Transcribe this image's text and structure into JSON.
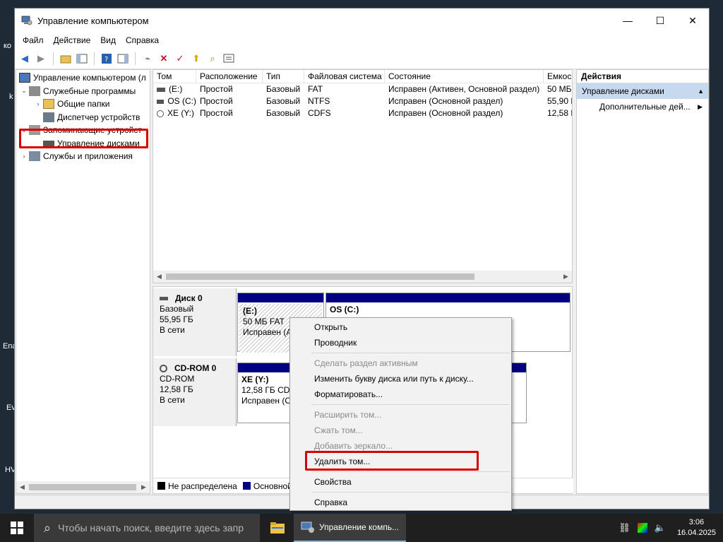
{
  "window": {
    "title": "Управление компьютером",
    "min": "—",
    "max": "☐",
    "close": "✕"
  },
  "menu": [
    "Файл",
    "Действие",
    "Вид",
    "Справка"
  ],
  "tree": [
    {
      "label": "Управление компьютером (л",
      "level": 0,
      "exp": ""
    },
    {
      "label": "Служебные программы",
      "level": 1,
      "exp": "⌄"
    },
    {
      "label": "Общие папки",
      "level": 2,
      "exp": "›"
    },
    {
      "label": "Диспетчер устройств",
      "level": 2,
      "exp": ""
    },
    {
      "label": "Запоминающие устройст",
      "level": 1,
      "exp": "⌄"
    },
    {
      "label": "Управление дисками",
      "level": 2,
      "exp": ""
    },
    {
      "label": "Службы и приложения",
      "level": 1,
      "exp": "›"
    }
  ],
  "volume_table": {
    "headers": [
      "Том",
      "Расположение",
      "Тип",
      "Файловая система",
      "Состояние",
      "Емкос"
    ],
    "rows": [
      [
        "(E:)",
        "Простой",
        "Базовый",
        "FAT",
        "Исправен (Активен, Основной раздел)",
        "50 МБ"
      ],
      [
        "OS (C:)",
        "Простой",
        "Базовый",
        "NTFS",
        "Исправен (Основной раздел)",
        "55,90 Г"
      ],
      [
        "XE (Y:)",
        "Простой",
        "Базовый",
        "CDFS",
        "Исправен (Основной раздел)",
        "12,58 Г"
      ]
    ]
  },
  "disks": {
    "disk0": {
      "name": "Диск 0",
      "type": "Базовый",
      "size": "55,95 ГБ",
      "status": "В сети"
    },
    "disk0_p1": {
      "title": "(E:)",
      "line1": "50 МБ FAT",
      "line2": "Исправен (А"
    },
    "disk0_p2": {
      "title": "OS  (C:)"
    },
    "cdrom": {
      "name": "CD-ROM 0",
      "type": "CD-ROM",
      "size": "12,58 ГБ",
      "status": "В сети"
    },
    "cdrom_p1": {
      "title": "XE  (Y:)",
      "line1": "12,58 ГБ CDF",
      "line2": "Исправен (О"
    }
  },
  "legend": {
    "unallocated": "Не распределена",
    "primary": "Основной",
    "unallocated_color": "#000000",
    "primary_color": "#000080"
  },
  "actions": {
    "header": "Действия",
    "section": "Управление дисками",
    "item": "Дополнительные дей..."
  },
  "context_menu": {
    "open": "Открыть",
    "explore": "Проводник",
    "mark_active": "Сделать раздел активным",
    "change_letter": "Изменить букву диска или путь к диску...",
    "format": "Форматировать...",
    "extend": "Расширить том...",
    "shrink": "Сжать том...",
    "mirror": "Добавить зеркало...",
    "delete": "Удалить том...",
    "properties": "Свойства",
    "help": "Справка"
  },
  "taskbar": {
    "search_placeholder": "Чтобы начать поиск, введите здесь запр",
    "app_label": "Управление компь...",
    "time": "3:06",
    "date": "16.04.2025"
  },
  "desktop_fragments": [
    "Ena",
    "Ev",
    "HV",
    "ко",
    "k"
  ],
  "colors": {
    "accent_highlight": "#d40000",
    "selection": "#c6d9ee",
    "volume_bar": "#000080"
  }
}
